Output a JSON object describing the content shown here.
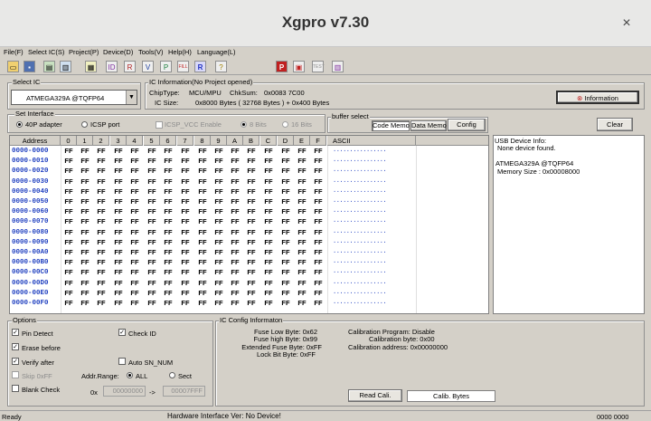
{
  "window": {
    "title": "Xgpro v7.30",
    "close": "×"
  },
  "menu": [
    "File(F)",
    "Select IC(S)",
    "Project(P)",
    "Device(D)",
    "Tools(V)",
    "Help(H)",
    "Language(L)"
  ],
  "select_ic": {
    "group": "Select IC",
    "value": "ATMEGA329A  @TQFP64"
  },
  "ic_info": {
    "group": "IC Information(No Project opened)",
    "chip_type_label": "ChipType:",
    "chip_type": "MCU/MPU",
    "chksum_label": "ChkSum:",
    "chksum": "0x0083 7C00",
    "size_label": "IC Size:",
    "size": "0x8000 Bytes ( 32768 Bytes ) + 0x400 Bytes",
    "info_button": "Information"
  },
  "interface": {
    "group": "Set Interface",
    "opt1": "40P adapter",
    "opt2": "ICSP port",
    "icsp_vcc": "ICSP_VCC Enable",
    "bits8": "8 Bits",
    "bits16": "16 Bits"
  },
  "buffer": {
    "group": "buffer select",
    "code": "Code Memo",
    "data": "Data Memo",
    "config": "Config"
  },
  "clear_button": "Clear",
  "grid": {
    "address_header": "Address",
    "cols": [
      "0",
      "1",
      "2",
      "3",
      "4",
      "5",
      "6",
      "7",
      "8",
      "9",
      "A",
      "B",
      "C",
      "D",
      "E",
      "F"
    ],
    "ascii_header": "ASCII",
    "value": "FF",
    "ascii": "................",
    "rows": [
      "0000-0000",
      "0000-0010",
      "0000-0020",
      "0000-0030",
      "0000-0040",
      "0000-0050",
      "0000-0060",
      "0000-0070",
      "0000-0080",
      "0000-0090",
      "0000-00A0",
      "0000-00B0",
      "0000-00C0",
      "0000-00D0",
      "0000-00E0",
      "0000-00F0"
    ]
  },
  "device_info": {
    "l1": "USB Device Info:",
    "l2": "None device found.",
    "l3": "ATMEGA329A   @TQFP64",
    "l4": "Memory Size : 0x00008000"
  },
  "options": {
    "group": "Options",
    "pin_detect": "Pin Detect",
    "check_id": "Check ID",
    "erase_before": "Erase before",
    "verify_after": "Verify after",
    "auto_sn": "Auto SN_NUM",
    "skip_ff": "Skip 0xFF",
    "blank_check": "Blank Check",
    "addr_range": "Addr.Range:",
    "all": "ALL",
    "sect": "Sect",
    "ox": "0x",
    "from": "00000000",
    "arrow": "->",
    "to": "00007FFF"
  },
  "config": {
    "group": "IC Config Informaton",
    "fuse_low": "Fuse Low Byte: 0x62",
    "fuse_high": "Fuse high Byte: 0x99",
    "ext_fuse": "Extended Fuse Byte: 0xFF",
    "lock": "Lock Bit Byte: 0xFF",
    "cal_prog": "Calibration Program: Disable",
    "cal_byte": "Calibration byte: 0x00",
    "cal_addr": "Calibration address: 0x00000000",
    "read_cali": "Read Cali.",
    "calib_bytes": "Calib. Bytes"
  },
  "status": {
    "left": "Ready",
    "center": "Hardware Interface Ver: No Device!",
    "right": "0000 0000"
  }
}
